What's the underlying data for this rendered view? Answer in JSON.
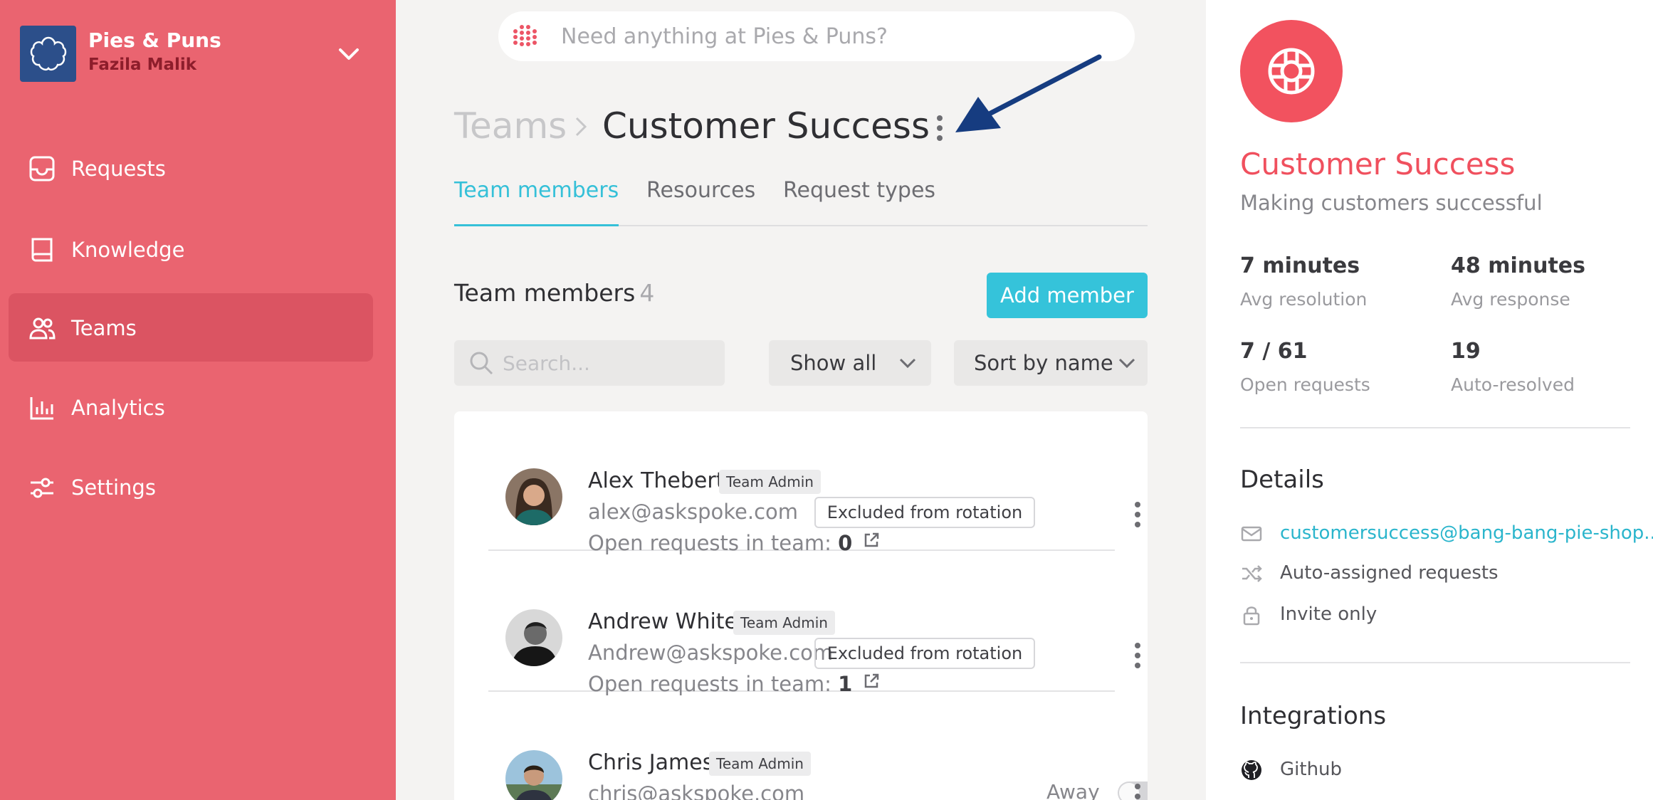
{
  "sidebar": {
    "org_name": "Pies & Puns",
    "user_name": "Fazila Malik",
    "items": [
      {
        "label": "Requests",
        "icon": "inbox-icon"
      },
      {
        "label": "Knowledge",
        "icon": "book-icon"
      },
      {
        "label": "Teams",
        "icon": "people-icon",
        "active": true
      },
      {
        "label": "Analytics",
        "icon": "bar-chart-icon"
      },
      {
        "label": "Settings",
        "icon": "sliders-icon"
      }
    ]
  },
  "search": {
    "placeholder": "Need anything at Pies & Puns?"
  },
  "header": {
    "breadcrumb_parent": "Teams",
    "title": "Customer Success"
  },
  "tabs": [
    {
      "label": "Team members",
      "active": true
    },
    {
      "label": "Resources"
    },
    {
      "label": "Request types"
    }
  ],
  "members_section": {
    "heading": "Team members",
    "count": "4",
    "add_label": "Add member",
    "search_placeholder": "Search...",
    "filter_value": "Show all",
    "sort_value": "Sort by name"
  },
  "members": [
    {
      "name": "Alex Thebert",
      "role": "Team Admin",
      "email": "alex@askspoke.com",
      "open_label": "Open requests in team:",
      "open_count": "0",
      "status": "Excluded from rotation"
    },
    {
      "name": "Andrew White",
      "role": "Team Admin",
      "email": "Andrew@askspoke.com",
      "open_label": "Open requests in team:",
      "open_count": "1",
      "status": "Excluded from rotation"
    },
    {
      "name": "Chris James",
      "role": "Team Admin",
      "email": "chris@askspoke.com",
      "away_label": "Away"
    }
  ],
  "panel": {
    "team_name": "Customer Success",
    "description": "Making customers successful",
    "stats": [
      {
        "value": "7 minutes",
        "label": "Avg resolution"
      },
      {
        "value": "48 minutes",
        "label": "Avg response"
      },
      {
        "value": "7 / 61",
        "label": "Open requests"
      },
      {
        "value": "19",
        "label": "Auto-resolved"
      }
    ],
    "details_title": "Details",
    "details": [
      {
        "icon": "mail-icon",
        "text": "customersuccess@bang-bang-pie-shop...."
      },
      {
        "icon": "shuffle-icon",
        "text": "Auto-assigned requests"
      },
      {
        "icon": "lock-icon",
        "text": "Invite only"
      }
    ],
    "integrations_title": "Integrations",
    "integrations": [
      {
        "icon": "github-icon",
        "text": "Github"
      }
    ]
  },
  "colors": {
    "sidebar": "#ea6470",
    "accent": "#35c3da",
    "brand": "#f0505e"
  }
}
